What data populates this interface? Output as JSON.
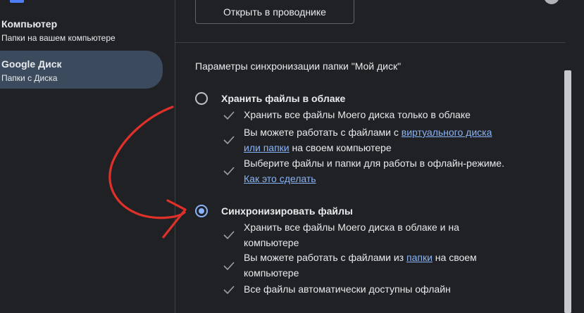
{
  "sidebar": {
    "items": [
      {
        "title": "Компьютер",
        "subtitle": "Папки на вашем компьютере",
        "active": false
      },
      {
        "title": "Google Диск",
        "subtitle": "Папки с Диска",
        "active": true
      }
    ]
  },
  "panel": {
    "open_button": "Открыть в проводнике",
    "section_title": "Параметры синхронизации папки \"Мой диск\"",
    "option_cloud": {
      "label": "Хранить файлы в облаке",
      "checked": false,
      "bullet1": "Хранить все файлы Моего диска только в облаке",
      "bullet2_pre": "Вы можете работать с файлами с ",
      "bullet2_link_a": "виртуального диска",
      "bullet2_link_b": "или папки",
      "bullet2_post": " на своем компьютере",
      "bullet3": "Выберите файлы и папки для работы в офлайн-режиме.",
      "bullet3_link": "Как это сделать"
    },
    "option_sync": {
      "label": "Синхронизировать файлы",
      "checked": true,
      "bullet1_a": "Хранить все файлы Моего диска в облаке и на",
      "bullet1_b": "компьютере",
      "bullet2_pre": "Вы можете работать с файлами из ",
      "bullet2_link": "папки",
      "bullet2_post": " на своем",
      "bullet2_b": "компьютере",
      "bullet3": "Все файлы автоматически доступны офлайн"
    }
  },
  "colors": {
    "background": "#202124",
    "active_nav": "#3c4a5e",
    "link": "#8ab4f8",
    "annotation": "#e0302a"
  },
  "icons": {
    "check": "check-icon",
    "radio": "radio-icon"
  }
}
